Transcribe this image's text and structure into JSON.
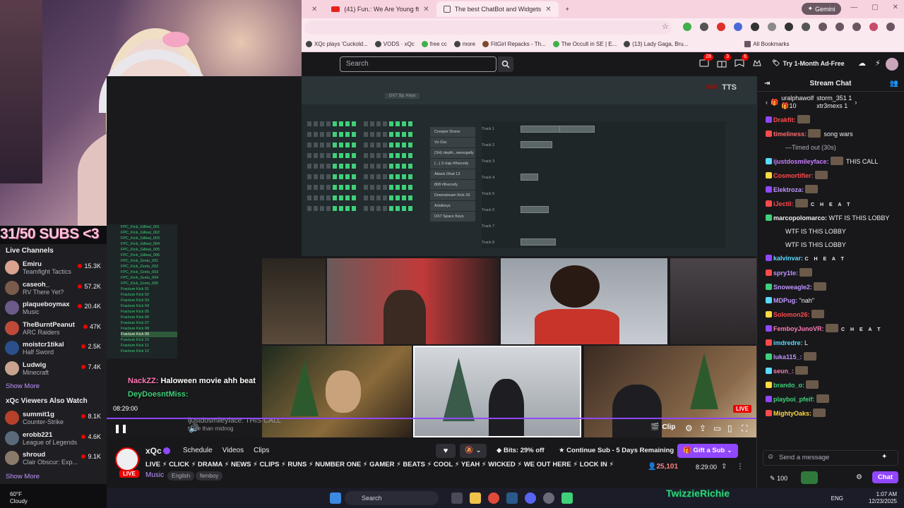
{
  "browser": {
    "tabs": [
      {
        "label": "(41) Fun.: We Are Young ft",
        "icon": "youtube-icon"
      },
      {
        "label": "The best ChatBot and Widgets",
        "icon": "chatbot-icon"
      }
    ],
    "gemini_label": "Gemini",
    "bookmarks": [
      "XQc plays 'Cuckold...",
      "VODS · xQc",
      "free cc",
      "more",
      "FitGirl Repacks - Th...",
      "The Occult in SE | E...",
      "(13) Lady Gaga, Bru...",
      "All Bookmarks"
    ]
  },
  "twitch_top": {
    "search_placeholder": "Search",
    "notifications": [
      {
        "icon": "inbox-icon",
        "count": "28"
      },
      {
        "icon": "gift-icon",
        "count": "3"
      },
      {
        "icon": "prime-icon",
        "count": "6"
      }
    ],
    "ad_free_label": "Try 1-Month Ad-Free"
  },
  "overlay": {
    "subs_banner": "31/50 SUBS <3",
    "chat_line1_user": "NackZZ:",
    "chat_line1_text": "Haloween movie ahh beat",
    "chat_line2_user": "DeyDoesntMiss:",
    "timestamp": "08:29:00",
    "faded_user": "ijustdosmileyface:",
    "faded_text": "THIS CALL",
    "faded_text2": "twice than midnog",
    "watermark": "TwizzieRichie"
  },
  "fl_studio": {
    "tts_label": "TTS",
    "pattern_label": "DX7 Sp. Keys",
    "instruments": [
      "Creeper Drone",
      "Vo Osc",
      "(SH) depth...wenogally",
      "(...) 3 clap #thecody",
      "Attack Ohat 13",
      "808 #thecody",
      "Downstream Kick 03",
      "Artstkeys",
      "DX7 Space Keys"
    ],
    "tracks": [
      "Track 1",
      "Track 2",
      "Track 3",
      "Track 4",
      "Track 5",
      "Track 6",
      "Track 7",
      "Track 8"
    ],
    "files": [
      "FPC_Kick_Gilleal_001",
      "FPC_Kick_Gilleal_002",
      "FPC_Kick_Gilleal_003",
      "FPC_Kick_Gilleal_004",
      "FPC_Kick_Gilleal_005",
      "FPC_Kick_Gilleal_006",
      "FPC_Kick_Grets_001",
      "FPC_Kick_Grets_002",
      "FPC_Kick_Grets_003",
      "FPC_Kick_Grets_004",
      "FPC_Kick_Grets_005",
      "Fracture Kick 01",
      "Fracture Kick 02",
      "Fracture Kick 03",
      "Fracture Kick 04",
      "Fracture Kick 05",
      "Fracture Kick 06",
      "Fracture Kick 07",
      "Fracture Kick 08",
      "Fracture Kick 09",
      "Fracture Kick 10",
      "Fracture Kick 11",
      "Fracture Kick 12"
    ]
  },
  "sidebar": {
    "live_title": "Live Channels",
    "channels": [
      {
        "name": "Emiru",
        "game": "Teamfight Tactics",
        "viewers": "15.3K",
        "color": "#d9a38f"
      },
      {
        "name": "caseoh_",
        "game": "RV There Yet?",
        "viewers": "57.2K",
        "color": "#7a5a4a"
      },
      {
        "name": "plaqueboymax",
        "game": "Music",
        "viewers": "20.4K",
        "color": "#6b5b8a"
      },
      {
        "name": "TheBurntPeanut",
        "game": "ARC Raiders",
        "viewers": "47K",
        "color": "#c04a3a"
      },
      {
        "name": "moistcr1tikal",
        "game": "Half Sword",
        "viewers": "2.5K",
        "color": "#2a4f8a"
      },
      {
        "name": "Ludwig",
        "game": "Minecraft",
        "viewers": "7.4K",
        "color": "#c9a38f"
      }
    ],
    "show_more": "Show More",
    "also_title": "xQc Viewers Also Watch",
    "also": [
      {
        "name": "summit1g",
        "game": "Counter-Strike",
        "viewers": "8.1K",
        "color": "#b5412a"
      },
      {
        "name": "erobb221",
        "game": "League of Legends",
        "viewers": "4.6K",
        "color": "#5a6a7a"
      },
      {
        "name": "shroud",
        "game": "Clair Obscur: Exp...",
        "viewers": "9.1K",
        "color": "#8a7a6a"
      }
    ],
    "show_more2": "Show More",
    "weather_temp": "60°F",
    "weather_desc": "Cloudy"
  },
  "player": {
    "clip_label": "Clip",
    "live_label": "LIVE"
  },
  "channel": {
    "name": "xQc",
    "tabs": [
      "Schedule",
      "Videos",
      "Clips"
    ],
    "title": "LIVE ⚡ CLICK ⚡ DRAMA ⚡ NEWS ⚡ CLIPS ⚡ RUNS ⚡ NUMBER ONE ⚡ GAMER ⚡ BEATS ⚡ COOL ⚡ YEAH ⚡ WICKED ⚡ WE OUT HERE ⚡ LOCK IN ⚡",
    "category": "Music",
    "tags": [
      "English",
      "femboy"
    ],
    "live_badge": "LIVE",
    "bits_label": "Bits: 29% off",
    "continue_sub_label": "Continue Sub - 5 Days Remaining",
    "gift_label": "Gift a Sub",
    "viewer_count": "25,101",
    "uptime": "8:29:00"
  },
  "chat": {
    "header": "Stream Chat",
    "gifters": [
      {
        "name": "uralphawolf",
        "count": "10"
      },
      {
        "name": "storm_351",
        "count": "1"
      },
      {
        "name": "xtr3mexs",
        "count": "1"
      }
    ],
    "messages": [
      {
        "user": "Drakfit:",
        "color": "#ff4a4a",
        "text": "",
        "emote": true
      },
      {
        "user": "timeliness:",
        "color": "#ff6b6b",
        "text": "song wars",
        "emote": true
      },
      {
        "user": "",
        "color": "#adadb8",
        "text": "—Timed out (30s)",
        "emote": false
      },
      {
        "user": "ijustdosmileyface:",
        "color": "#c77dff",
        "text": "THIS CALL",
        "emote": true
      },
      {
        "user": "Cosmortifier:",
        "color": "#ff4a4a",
        "text": "",
        "emote": true
      },
      {
        "user": "Elektroza:",
        "color": "#bf94ff",
        "text": "",
        "emote": true
      },
      {
        "user": "iJectil:",
        "color": "#ff4a4a",
        "text": "C H E A T",
        "emote": true
      },
      {
        "user": "marcopolomarco:",
        "color": "#efeff1",
        "text": "WTF IS THIS LOBBY",
        "emote": false
      },
      {
        "user": "",
        "color": "#efeff1",
        "text": "WTF IS THIS LOBBY",
        "emote": false
      },
      {
        "user": "",
        "color": "#efeff1",
        "text": "WTF IS THIS LOBBY",
        "emote": false
      },
      {
        "user": "kalvinvar:",
        "color": "#5ad9ff",
        "text": "C H E A T",
        "emote": false
      },
      {
        "user": "spry1te:",
        "color": "#bf94ff",
        "text": "",
        "emote": true
      },
      {
        "user": "Snoweagle2:",
        "color": "#bf94ff",
        "text": "",
        "emote": true
      },
      {
        "user": "MDPug:",
        "color": "#bf94ff",
        "text": "\"nah\"",
        "emote": false
      },
      {
        "user": "Solomon26:",
        "color": "#ff4a4a",
        "text": "",
        "emote": true
      },
      {
        "user": "FemboyJunoVR:",
        "color": "#ff7ab7",
        "text": "C H E A T",
        "emote": true
      },
      {
        "user": "imdredre:",
        "color": "#5ad9ff",
        "text": "L",
        "emote": false
      },
      {
        "user": "luka115_:",
        "color": "#bf94ff",
        "text": "",
        "emote": true
      },
      {
        "user": "seun_:",
        "color": "#ff7ab7",
        "text": "",
        "emote": true
      },
      {
        "user": "brando_o:",
        "color": "#3fd07a",
        "text": "",
        "emote": true
      },
      {
        "user": "playboi_pfeif:",
        "color": "#3fd07a",
        "text": "",
        "emote": true
      },
      {
        "user": "MightyOaks:",
        "color": "#ffd93f",
        "text": "",
        "emote": true
      }
    ],
    "input_placeholder": "Send a message",
    "points": "100",
    "chat_button": "Chat"
  },
  "taskbar": {
    "search_placeholder": "Search",
    "lang": "ENG",
    "time": "1:07 AM",
    "date": "12/23/2025"
  }
}
